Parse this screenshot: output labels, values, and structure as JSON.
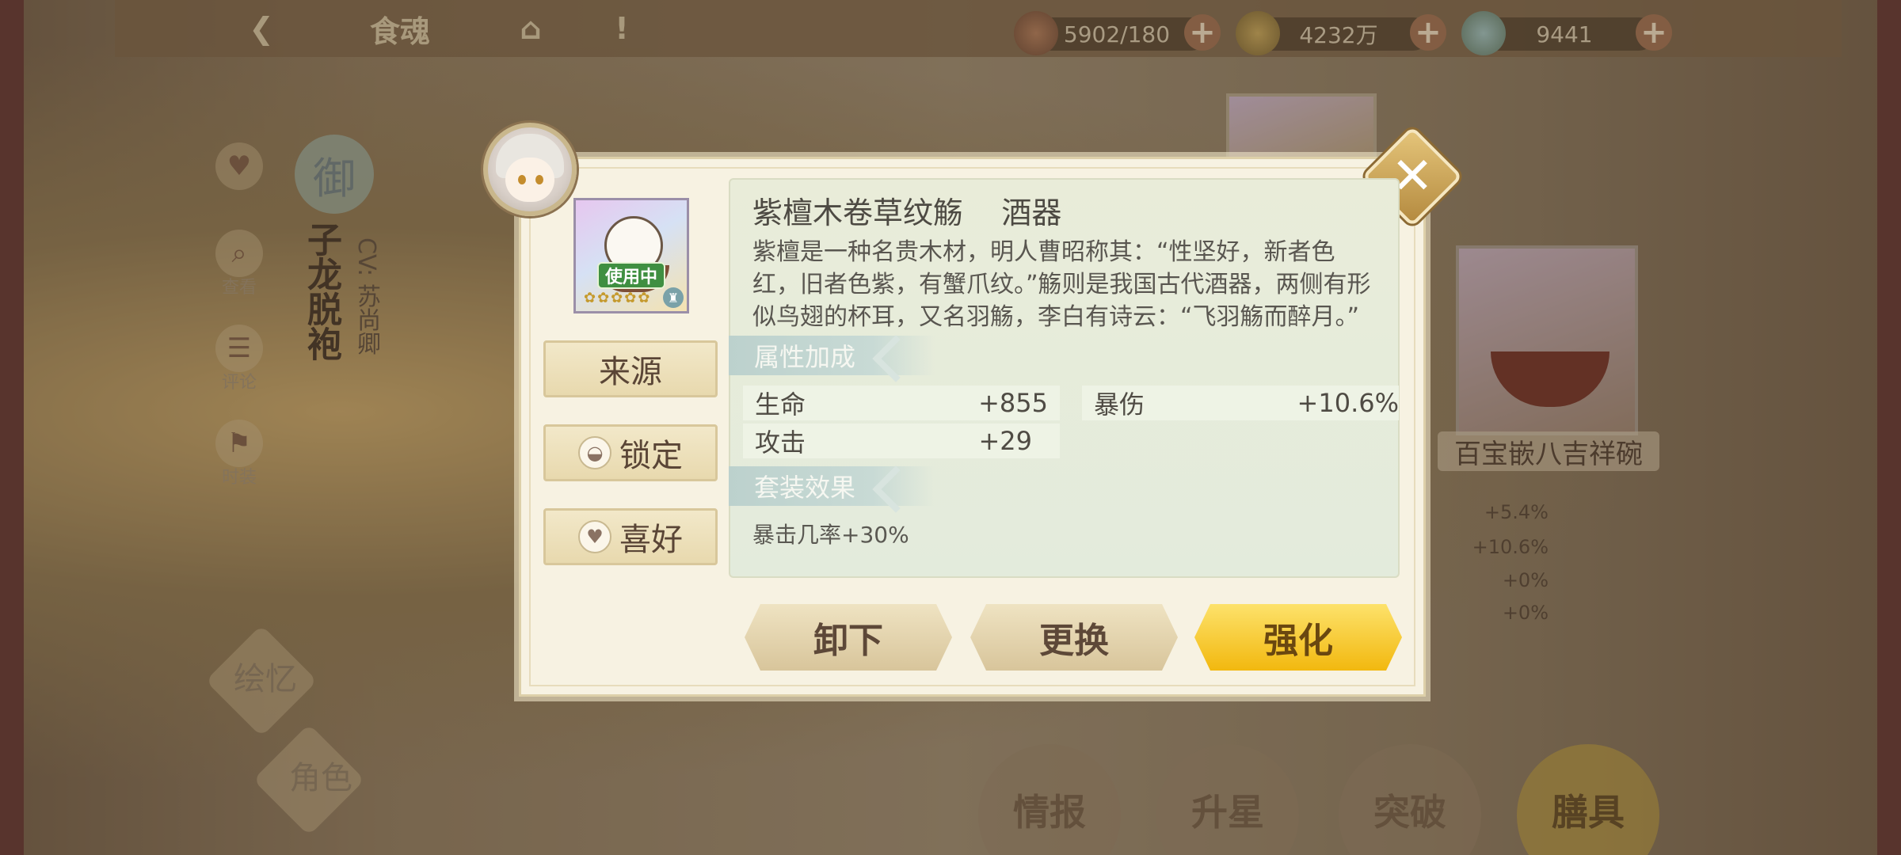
{
  "topbar": {
    "back_icon": "back-arrow-icon",
    "title": "食魂",
    "home_icon": "home-icon",
    "alert_icon": "exclamation-icon",
    "resources": [
      {
        "name": "stamina",
        "icon": "stamina-icon",
        "value": "5902/180"
      },
      {
        "name": "coins",
        "icon": "coin-icon",
        "value": "4232万"
      },
      {
        "name": "gems",
        "icon": "gem-icon",
        "value": "9441"
      }
    ],
    "plus": "+"
  },
  "left_sidebar": {
    "badge": "御",
    "items": [
      {
        "icon": "heart-icon",
        "label": ""
      },
      {
        "icon": "magnifier-icon",
        "label": "查看"
      },
      {
        "icon": "comment-icon",
        "label": "评论"
      },
      {
        "icon": "wardrobe-icon",
        "label": "时装"
      }
    ],
    "character_name": "子龙脱袍",
    "cv": "CV: 苏尚卿",
    "bottom_badges": [
      "绘忆",
      "角色"
    ]
  },
  "background_item": {
    "name": "百宝嵌八吉祥碗",
    "stats": [
      "+5.4%",
      "+10.6%",
      "+0%",
      "+0%"
    ]
  },
  "bottom_tabs": [
    {
      "label": "情报",
      "active": false
    },
    {
      "label": "升星",
      "active": false
    },
    {
      "label": "突破",
      "active": false
    },
    {
      "label": "膳具",
      "active": true
    }
  ],
  "modal": {
    "in_use_label": "使用中",
    "stars": "✿✿✿✿✿",
    "left_buttons": {
      "source": "来源",
      "lock": "锁定",
      "favorite": "喜好"
    },
    "title": "紫檀木卷草纹觞",
    "category": "酒器",
    "description": "紫檀是一种名贵木材，明人曹昭称其：“性坚好，新者色红，旧者色紫，有蟹爪纹。”觞则是我国古代酒器，两侧有形似鸟翅的杯耳，又名羽觞，李白有诗云：“飞羽觞而醉月。”",
    "attributes_header": "属性加成",
    "attributes": [
      {
        "label": "生命",
        "value": "+855"
      },
      {
        "label": "暴伤",
        "value": "+10.6%"
      },
      {
        "label": "攻击",
        "value": "+29"
      }
    ],
    "set_header": "套装效果",
    "set_effect": "暴击几率+30%",
    "actions": {
      "unequip": "卸下",
      "replace": "更换",
      "enhance": "强化"
    },
    "close_symbol": "✕"
  },
  "colors": {
    "modal_bg": "#f7f2e2",
    "panel_bg": "#e9ecd9",
    "section_head": "#bcd1cd",
    "primary_button": "#f2b80f",
    "in_use_green": "#3f8f41"
  }
}
